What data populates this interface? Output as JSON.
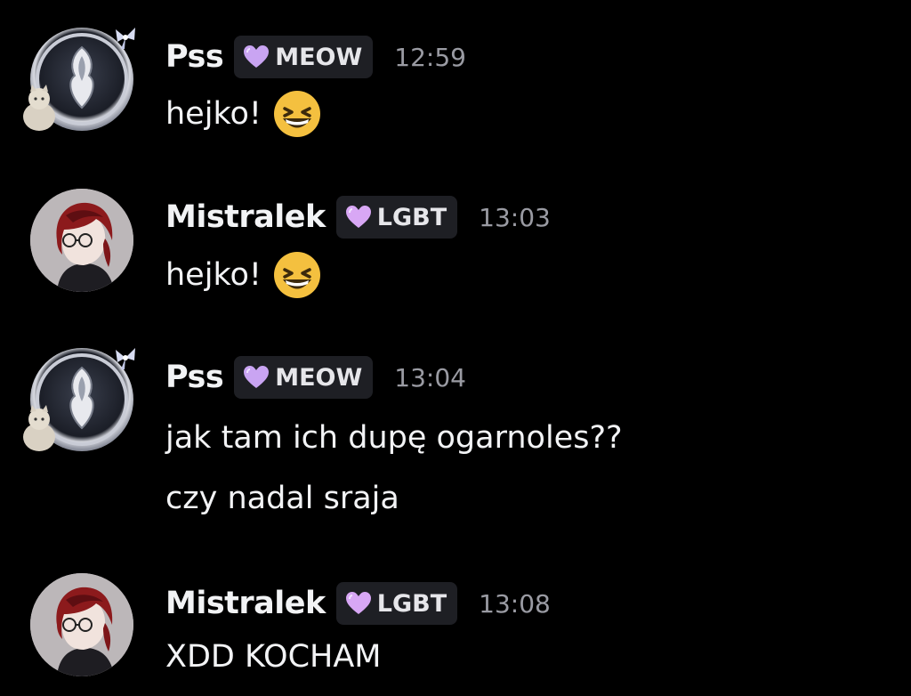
{
  "messages": [
    {
      "username": "Pss",
      "tag": "MEOW",
      "time": "12:59",
      "lines": [
        "hejko!"
      ],
      "emoji": "grinning-squinting-face-icon"
    },
    {
      "username": "Mistralek",
      "tag": "LGBT",
      "time": "13:03",
      "lines": [
        "hejko!"
      ],
      "emoji": "grinning-squinting-face-icon"
    },
    {
      "username": "Pss",
      "tag": "MEOW",
      "time": "13:04",
      "lines": [
        "jak tam ich dupę ogarnoles??",
        "czy nadal sraja"
      ]
    },
    {
      "username": "Mistralek",
      "tag": "LGBT",
      "time": "13:08",
      "lines": [
        "XDD KOCHAM"
      ]
    }
  ],
  "colors": {
    "background": "#000000",
    "text": "#f2f3f5",
    "timestamp": "#9a9ba3",
    "tag_bg": "#1e1f24",
    "heart": "#c9a4f2"
  }
}
